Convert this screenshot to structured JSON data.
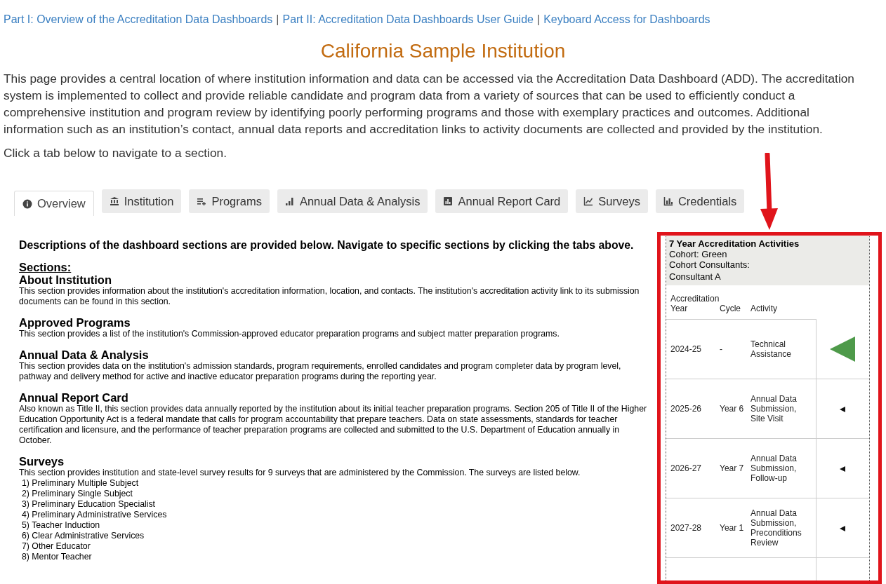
{
  "links": [
    "Part I: Overview of the Accreditation Data Dashboards",
    "Part II: Accreditation Data Dashboards User Guide",
    "Keyboard Access for Dashboards"
  ],
  "link_separator": "|",
  "title": "California Sample Institution",
  "intro": "This page provides a central location of where institution information and data can be accessed via the Accreditation Data Dashboard (ADD). The accreditation system is implemented to collect and provide reliable candidate and program data from a variety of sources that can be used to efficiently conduct a comprehensive institution and program review by identifying poorly performing programs and those with exemplary practices and outcomes. Additional information such as an institution’s contact, annual data reports and accreditation links to activity documents are collected and provided by the institution.",
  "instruction": "Click a tab below to navigate to a section.",
  "tabs": [
    {
      "label": "Overview",
      "kind": "info",
      "selected": true
    },
    {
      "label": "Institution",
      "kind": "bank",
      "selected": false
    },
    {
      "label": "Programs",
      "kind": "list",
      "selected": false
    },
    {
      "label": "Annual Data & Analysis",
      "kind": "signal",
      "selected": false
    },
    {
      "label": "Annual Report Card",
      "kind": "box",
      "selected": false
    },
    {
      "label": "Surveys",
      "kind": "line",
      "selected": false
    },
    {
      "label": "Credentials",
      "kind": "bars",
      "selected": false
    }
  ],
  "overview": {
    "lead": "Descriptions of the dashboard sections are provided below. Navigate to specific sections by clicking the tabs above.",
    "sections_label": "Sections:",
    "sections": [
      {
        "heading": "About Institution",
        "text": "This section provides information about the institution's accreditation information, location, and contacts. The institution's accreditation activity link to its submission documents can be found in this section."
      },
      {
        "heading": "Approved Programs",
        "text": "This section provides a list of the institution's Commission-approved educator preparation programs and subject matter preparation programs."
      },
      {
        "heading": "Annual Data & Analysis",
        "text": "This section provides data on the institution's admission standards, program requirements, enrolled candidates and program completer data by program level, pathway and delivery method for active and inactive educator preparation programs during the reporting year."
      },
      {
        "heading": "Annual Report Card",
        "text": "Also known as Title II, this section provides data annually reported by the institution about its initial teacher preparation programs. Section 205 of Title II of the Higher Education Opportunity Act is a federal mandate that calls for program accountability that prepare teachers. Data on state assessments, standards for teacher certification and licensure, and the performance of teacher preparation programs are collected and submitted to the U.S. Department of Education annually in October."
      },
      {
        "heading": "Surveys",
        "text": "This section provides institution and state-level survey results for 9 surveys that are administered by the Commission. The surveys are listed below.",
        "items": [
          "1) Preliminary Multiple Subject",
          "2) Preliminary Single Subject",
          "3) Preliminary Education Specialist",
          "4) Preliminary Administrative Services",
          "5) Teacher Induction",
          "6) Clear Administrative Services",
          "7) Other Educator",
          "8) Mentor Teacher"
        ]
      }
    ]
  },
  "activities": {
    "title": "7 Year Accreditation Activities",
    "cohort": "Cohort: Green",
    "consultants_label": "Cohort Consultants:",
    "consultant": "Consultant A",
    "columns": [
      "Accreditation Year",
      "Cycle",
      "Activity"
    ],
    "rows": [
      {
        "year": "2024-25",
        "cycle": "-",
        "activity": "Technical Assistance",
        "current": true
      },
      {
        "year": "2025-26",
        "cycle": "Year 6",
        "activity": "Annual Data Submission, Site Visit",
        "current": false
      },
      {
        "year": "2026-27",
        "cycle": "Year 7",
        "activity": "Annual Data Submission, Follow-up",
        "current": false
      },
      {
        "year": "2027-28",
        "cycle": "Year 1",
        "activity": "Annual Data Submission, Preconditions Review",
        "current": false
      }
    ]
  }
}
